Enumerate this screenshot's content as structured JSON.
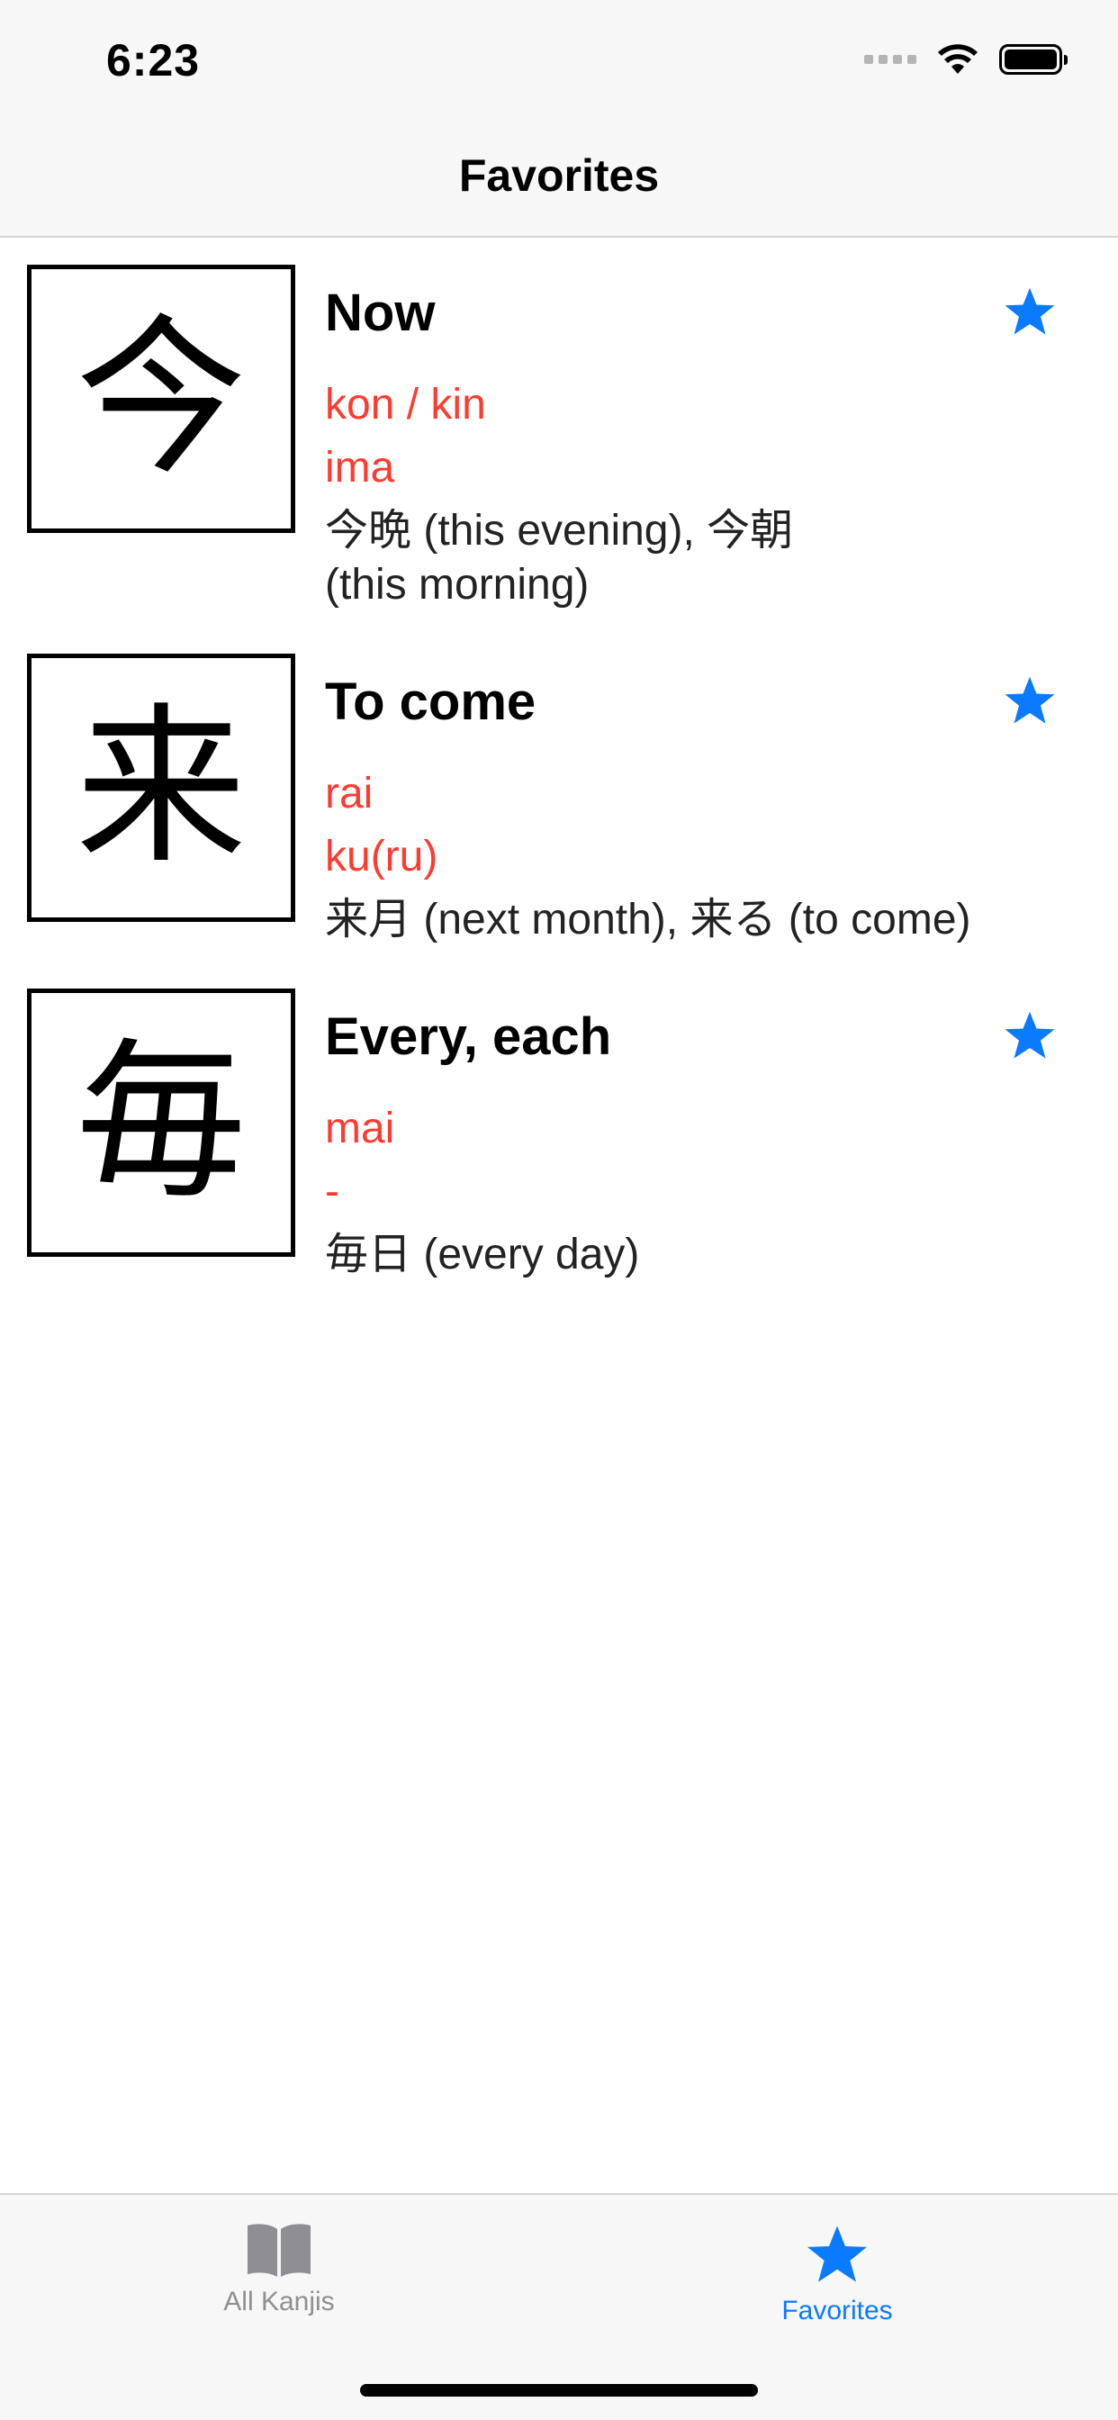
{
  "status": {
    "time": "6:23"
  },
  "nav": {
    "title": "Favorites"
  },
  "items": [
    {
      "kanji": "今",
      "meaning": "Now",
      "on": "kon / kin",
      "kun": "ima",
      "examples": "今晩  (this evening), 今朝 (this morning)",
      "favorite": true
    },
    {
      "kanji": "来",
      "meaning": "To come",
      "on": "rai",
      "kun": "ku(ru)",
      "examples": "来月 (next month), 来る (to come)",
      "favorite": true
    },
    {
      "kanji": "毎",
      "meaning": "Every, each",
      "on": "mai",
      "kun": "-",
      "examples": "毎日 (every day)",
      "favorite": true
    }
  ],
  "tabs": [
    {
      "label": "All Kanjis",
      "icon": "book-icon",
      "selected": false
    },
    {
      "label": "Favorites",
      "icon": "star-icon",
      "selected": true
    }
  ],
  "colors": {
    "accent": "#0a7aff",
    "reading": "#ff3b30",
    "inactive": "#8e8e93"
  }
}
